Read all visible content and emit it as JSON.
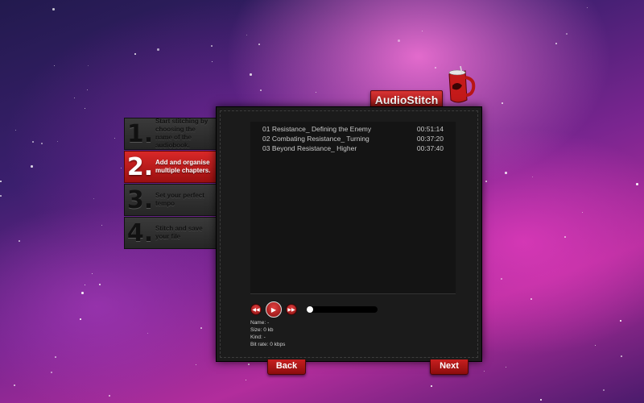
{
  "app": {
    "logo_text": "AudioStitch"
  },
  "steps": [
    {
      "number": "1.",
      "text": "Start stitching by choosing the name of the audiobook."
    },
    {
      "number": "2.",
      "text": "Add and organise multiple chapters."
    },
    {
      "number": "3.",
      "text": "Set your perfect tempo"
    },
    {
      "number": "4.",
      "text": "Stitch and save your file"
    }
  ],
  "active_step": 2,
  "tracks": [
    {
      "title": "01 Resistance_ Defining the Enemy",
      "duration": "00:51:14"
    },
    {
      "title": "02 Combating Resistance_ Turning",
      "duration": "00:37:20"
    },
    {
      "title": "03 Beyond Resistance_ Higher",
      "duration": "00:37:40"
    }
  ],
  "player": {
    "rewind_icon": "rewind-icon",
    "play_icon": "play-icon",
    "forward_icon": "fast-forward-icon",
    "progress": 0
  },
  "info": {
    "name": "Name:  -",
    "size": "Size:  0 kb",
    "kind": "Kind:  -",
    "bitrate": "Bit rate:  0 kbps"
  },
  "nav": {
    "back_label": "Back",
    "next_label": "Next"
  },
  "colors": {
    "accent": "#c71f1f",
    "panel": "#1b1b1b"
  }
}
